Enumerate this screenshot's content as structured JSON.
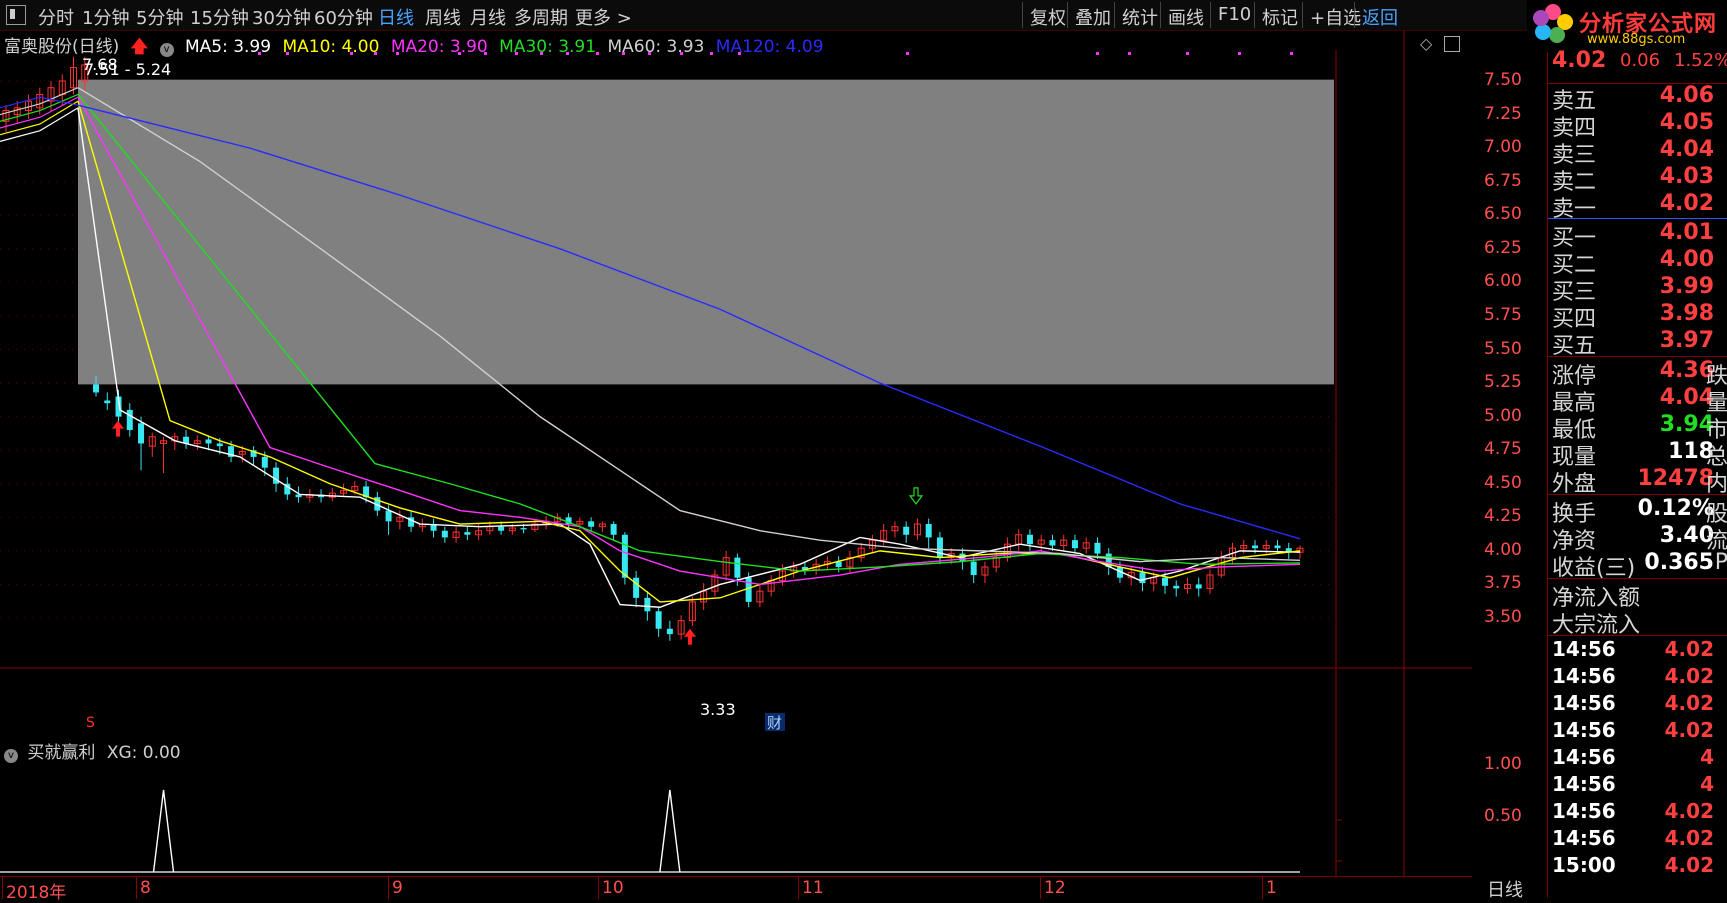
{
  "toolbar": {
    "periods": [
      "分时",
      "1分钟",
      "5分钟",
      "15分钟",
      "30分钟",
      "60分钟",
      "日线",
      "周线",
      "月线",
      "多周期",
      "更多 >"
    ],
    "active_period": "日线",
    "right_items": [
      "复权",
      "叠加",
      "统计",
      "画线",
      "F10",
      "标记",
      "+自选",
      "返回"
    ]
  },
  "logo": {
    "text": "分析家公式网",
    "url": "www.88gs.com"
  },
  "stock": {
    "name": "富奥股份(日线)"
  },
  "legend": {
    "ma5": {
      "label": "MA5: 3.99",
      "color": "#ffffff"
    },
    "ma10": {
      "label": "MA10: 4.00",
      "color": "#ffff00"
    },
    "ma20": {
      "label": "MA20: 3.90",
      "color": "#ff33ff"
    },
    "ma30": {
      "label": "MA30: 3.91",
      "color": "#22dd22"
    },
    "ma60": {
      "label": "MA60: 3.93",
      "color": "#d0d0d0"
    },
    "ma120": {
      "label": "MA120: 4.09",
      "color": "#2a2aff"
    }
  },
  "chart_annotations": {
    "high_label": "7.68",
    "range_label": "7.51 - 5.24",
    "low_label": "3.33",
    "s_marker": "S",
    "cai_marker": "财"
  },
  "chart_data": {
    "type": "candlestick",
    "y_ticks": [
      "7.50",
      "7.25",
      "7.00",
      "6.75",
      "6.50",
      "6.25",
      "6.00",
      "5.75",
      "5.50",
      "5.25",
      "5.00",
      "4.75",
      "4.50",
      "4.25",
      "4.00",
      "3.75",
      "3.50"
    ],
    "ylim": [
      3.28,
      7.72
    ],
    "x_month_labels": [
      "2018年",
      "8",
      "9",
      "10",
      "11",
      "12",
      "1"
    ],
    "box_range": [
      5.24,
      7.51
    ],
    "candles": [
      [
        7.2,
        7.28,
        7.12,
        7.32
      ],
      [
        7.25,
        7.3,
        7.18,
        7.35
      ],
      [
        7.28,
        7.35,
        7.22,
        7.4
      ],
      [
        7.3,
        7.4,
        7.25,
        7.45
      ],
      [
        7.35,
        7.45,
        7.28,
        7.5
      ],
      [
        7.4,
        7.5,
        7.32,
        7.55
      ],
      [
        7.45,
        7.6,
        7.4,
        7.68
      ],
      [
        7.5,
        7.62,
        7.42,
        7.68
      ],
      [
        5.24,
        5.18,
        5.15,
        5.3
      ],
      [
        5.12,
        5.1,
        5.05,
        5.18
      ],
      [
        5.15,
        5.0,
        4.95,
        5.2
      ],
      [
        5.05,
        4.9,
        4.85,
        5.1
      ],
      [
        4.95,
        4.8,
        4.6,
        5.0
      ],
      [
        4.78,
        4.85,
        4.7,
        4.88
      ],
      [
        4.8,
        4.82,
        4.58,
        4.85
      ],
      [
        4.82,
        4.85,
        4.75,
        4.88
      ],
      [
        4.85,
        4.8,
        4.76,
        4.9
      ],
      [
        4.8,
        4.82,
        4.75,
        4.86
      ],
      [
        4.83,
        4.8,
        4.75,
        4.86
      ],
      [
        4.8,
        4.78,
        4.72,
        4.84
      ],
      [
        4.78,
        4.7,
        4.66,
        4.82
      ],
      [
        4.72,
        4.74,
        4.66,
        4.78
      ],
      [
        4.75,
        4.7,
        4.64,
        4.78
      ],
      [
        4.7,
        4.62,
        4.56,
        4.74
      ],
      [
        4.62,
        4.5,
        4.44,
        4.66
      ],
      [
        4.5,
        4.42,
        4.38,
        4.55
      ],
      [
        4.42,
        4.4,
        4.36,
        4.48
      ],
      [
        4.4,
        4.42,
        4.36,
        4.46
      ],
      [
        4.42,
        4.4,
        4.36,
        4.46
      ],
      [
        4.4,
        4.43,
        4.37,
        4.47
      ],
      [
        4.43,
        4.45,
        4.4,
        4.5
      ],
      [
        4.45,
        4.48,
        4.42,
        4.52
      ],
      [
        4.48,
        4.4,
        4.36,
        4.52
      ],
      [
        4.4,
        4.3,
        4.26,
        4.44
      ],
      [
        4.3,
        4.22,
        4.12,
        4.34
      ],
      [
        4.22,
        4.25,
        4.16,
        4.3
      ],
      [
        4.25,
        4.18,
        4.14,
        4.3
      ],
      [
        4.18,
        4.2,
        4.14,
        4.24
      ],
      [
        4.2,
        4.15,
        4.1,
        4.24
      ],
      [
        4.15,
        4.1,
        4.06,
        4.18
      ],
      [
        4.1,
        4.14,
        4.06,
        4.18
      ],
      [
        4.14,
        4.12,
        4.08,
        4.18
      ],
      [
        4.12,
        4.15,
        4.08,
        4.2
      ],
      [
        4.15,
        4.18,
        4.12,
        4.22
      ],
      [
        4.18,
        4.15,
        4.12,
        4.22
      ],
      [
        4.15,
        4.17,
        4.12,
        4.2
      ],
      [
        4.17,
        4.16,
        4.13,
        4.2
      ],
      [
        4.16,
        4.2,
        4.14,
        4.24
      ],
      [
        4.2,
        4.22,
        4.16,
        4.26
      ],
      [
        4.22,
        4.25,
        4.18,
        4.28
      ],
      [
        4.25,
        4.2,
        4.16,
        4.28
      ],
      [
        4.2,
        4.22,
        4.16,
        4.25
      ],
      [
        4.22,
        4.18,
        4.15,
        4.25
      ],
      [
        4.18,
        4.2,
        4.14,
        4.22
      ],
      [
        4.2,
        4.12,
        4.08,
        4.22
      ],
      [
        4.12,
        3.8,
        3.75,
        4.14
      ],
      [
        3.8,
        3.65,
        3.58,
        3.85
      ],
      [
        3.65,
        3.55,
        3.48,
        3.7
      ],
      [
        3.55,
        3.42,
        3.36,
        3.58
      ],
      [
        3.42,
        3.38,
        3.33,
        3.48
      ],
      [
        3.38,
        3.48,
        3.34,
        3.52
      ],
      [
        3.48,
        3.62,
        3.44,
        3.66
      ],
      [
        3.62,
        3.7,
        3.56,
        3.76
      ],
      [
        3.7,
        3.82,
        3.66,
        3.86
      ],
      [
        3.82,
        3.95,
        3.78,
        4.0
      ],
      [
        3.95,
        3.8,
        3.74,
        3.98
      ],
      [
        3.8,
        3.62,
        3.58,
        3.84
      ],
      [
        3.62,
        3.7,
        3.58,
        3.76
      ],
      [
        3.7,
        3.78,
        3.66,
        3.82
      ],
      [
        3.78,
        3.85,
        3.74,
        3.9
      ],
      [
        3.85,
        3.88,
        3.8,
        3.92
      ],
      [
        3.88,
        3.86,
        3.82,
        3.92
      ],
      [
        3.86,
        3.9,
        3.82,
        3.94
      ],
      [
        3.9,
        3.92,
        3.86,
        3.96
      ],
      [
        3.92,
        3.88,
        3.84,
        3.96
      ],
      [
        3.88,
        3.95,
        3.84,
        4.0
      ],
      [
        3.95,
        4.02,
        3.92,
        4.06
      ],
      [
        4.02,
        4.08,
        3.98,
        4.12
      ],
      [
        4.08,
        4.15,
        4.04,
        4.2
      ],
      [
        4.15,
        4.18,
        4.1,
        4.22
      ],
      [
        4.18,
        4.12,
        4.06,
        4.22
      ],
      [
        4.12,
        4.2,
        4.08,
        4.24
      ],
      [
        4.2,
        4.1,
        4.02,
        4.24
      ],
      [
        4.1,
        3.95,
        3.9,
        4.14
      ],
      [
        3.95,
        3.98,
        3.9,
        4.02
      ],
      [
        3.98,
        3.92,
        3.86,
        4.02
      ],
      [
        3.92,
        3.82,
        3.76,
        3.96
      ],
      [
        3.82,
        3.88,
        3.76,
        3.92
      ],
      [
        3.88,
        3.95,
        3.84,
        4.0
      ],
      [
        3.95,
        4.05,
        3.92,
        4.1
      ],
      [
        4.05,
        4.12,
        4.0,
        4.16
      ],
      [
        4.12,
        4.05,
        4.0,
        4.16
      ],
      [
        4.05,
        4.08,
        4.0,
        4.12
      ],
      [
        4.08,
        4.04,
        4.0,
        4.12
      ],
      [
        4.04,
        4.08,
        4.0,
        4.12
      ],
      [
        4.08,
        4.02,
        3.98,
        4.12
      ],
      [
        4.02,
        4.06,
        3.98,
        4.1
      ],
      [
        4.06,
        3.98,
        3.94,
        4.1
      ],
      [
        3.98,
        3.88,
        3.82,
        4.02
      ],
      [
        3.88,
        3.8,
        3.76,
        3.92
      ],
      [
        3.8,
        3.84,
        3.74,
        3.88
      ],
      [
        3.84,
        3.76,
        3.7,
        3.88
      ],
      [
        3.76,
        3.8,
        3.7,
        3.84
      ],
      [
        3.8,
        3.74,
        3.68,
        3.84
      ],
      [
        3.74,
        3.72,
        3.66,
        3.78
      ],
      [
        3.72,
        3.75,
        3.68,
        3.8
      ],
      [
        3.75,
        3.72,
        3.66,
        3.8
      ],
      [
        3.72,
        3.82,
        3.68,
        3.86
      ],
      [
        3.82,
        3.95,
        3.8,
        4.0
      ],
      [
        3.95,
        4.02,
        3.9,
        4.06
      ],
      [
        4.02,
        4.04,
        3.98,
        4.08
      ],
      [
        4.04,
        4.02,
        3.98,
        4.08
      ],
      [
        4.02,
        4.04,
        3.98,
        4.08
      ],
      [
        4.04,
        4.02,
        3.98,
        4.08
      ],
      [
        4.02,
        3.99,
        3.94,
        4.06
      ],
      [
        3.99,
        4.02,
        3.94,
        4.04
      ]
    ],
    "ma_lines": {
      "ma5": [
        [
          78,
          7.3
        ],
        [
          120,
          5.05
        ],
        [
          175,
          4.82
        ],
        [
          240,
          4.7
        ],
        [
          300,
          4.42
        ],
        [
          360,
          4.4
        ],
        [
          420,
          4.2
        ],
        [
          480,
          4.18
        ],
        [
          560,
          4.2
        ],
        [
          590,
          4.05
        ],
        [
          620,
          3.6
        ],
        [
          660,
          3.58
        ],
        [
          720,
          3.75
        ],
        [
          800,
          3.9
        ],
        [
          860,
          4.1
        ],
        [
          900,
          4.05
        ],
        [
          960,
          3.95
        ],
        [
          1020,
          4.05
        ],
        [
          1080,
          3.98
        ],
        [
          1140,
          3.78
        ],
        [
          1180,
          3.85
        ],
        [
          1240,
          4.0
        ],
        [
          1300,
          3.99
        ]
      ],
      "ma10": [
        [
          78,
          7.35
        ],
        [
          170,
          4.97
        ],
        [
          220,
          4.82
        ],
        [
          270,
          4.7
        ],
        [
          330,
          4.5
        ],
        [
          400,
          4.32
        ],
        [
          460,
          4.2
        ],
        [
          540,
          4.22
        ],
        [
          580,
          4.15
        ],
        [
          620,
          3.85
        ],
        [
          660,
          3.62
        ],
        [
          720,
          3.65
        ],
        [
          800,
          3.85
        ],
        [
          880,
          4.0
        ],
        [
          940,
          3.95
        ],
        [
          1000,
          3.98
        ],
        [
          1060,
          3.98
        ],
        [
          1120,
          3.88
        ],
        [
          1170,
          3.8
        ],
        [
          1240,
          3.95
        ],
        [
          1300,
          4.0
        ]
      ],
      "ma20": [
        [
          78,
          7.38
        ],
        [
          270,
          4.77
        ],
        [
          330,
          4.62
        ],
        [
          400,
          4.45
        ],
        [
          460,
          4.3
        ],
        [
          520,
          4.25
        ],
        [
          580,
          4.18
        ],
        [
          620,
          4.0
        ],
        [
          680,
          3.85
        ],
        [
          760,
          3.75
        ],
        [
          840,
          3.82
        ],
        [
          900,
          3.9
        ],
        [
          980,
          3.95
        ],
        [
          1040,
          4.0
        ],
        [
          1100,
          3.92
        ],
        [
          1160,
          3.85
        ],
        [
          1220,
          3.88
        ],
        [
          1300,
          3.9
        ]
      ],
      "ma30": [
        [
          78,
          7.4
        ],
        [
          375,
          4.65
        ],
        [
          450,
          4.5
        ],
        [
          520,
          4.35
        ],
        [
          580,
          4.18
        ],
        [
          640,
          4.0
        ],
        [
          720,
          3.92
        ],
        [
          800,
          3.85
        ],
        [
          880,
          3.88
        ],
        [
          960,
          3.92
        ],
        [
          1040,
          3.98
        ],
        [
          1120,
          3.95
        ],
        [
          1200,
          3.9
        ],
        [
          1300,
          3.91
        ]
      ],
      "ma60": [
        [
          78,
          7.45
        ],
        [
          200,
          6.9
        ],
        [
          330,
          6.2
        ],
        [
          440,
          5.6
        ],
        [
          540,
          5.0
        ],
        [
          620,
          4.6
        ],
        [
          680,
          4.3
        ],
        [
          760,
          4.15
        ],
        [
          820,
          4.08
        ],
        [
          900,
          4.02
        ],
        [
          980,
          4.0
        ],
        [
          1060,
          3.98
        ],
        [
          1140,
          3.92
        ],
        [
          1220,
          3.95
        ],
        [
          1300,
          3.93
        ]
      ],
      "ma120": [
        [
          78,
          7.32
        ],
        [
          250,
          7.0
        ],
        [
          400,
          6.65
        ],
        [
          560,
          6.25
        ],
        [
          720,
          5.8
        ],
        [
          880,
          5.25
        ],
        [
          1040,
          4.78
        ],
        [
          1180,
          4.35
        ],
        [
          1300,
          4.09
        ]
      ]
    },
    "sub_indicator": {
      "name": "买就赢利",
      "label": "XG: 0.00",
      "y_ticks": [
        "1.00",
        "0.50"
      ],
      "spikes_at_candle": [
        14,
        59
      ]
    }
  },
  "sub_legend": {
    "name": "买就赢利",
    "value": "XG: 0.00"
  },
  "right_panel": {
    "last_price": "4.02",
    "change": "0.06",
    "change_pct": "1.52%",
    "asks": [
      {
        "label": "卖五",
        "price": "4.06"
      },
      {
        "label": "卖四",
        "price": "4.05"
      },
      {
        "label": "卖三",
        "price": "4.04"
      },
      {
        "label": "卖二",
        "price": "4.03"
      },
      {
        "label": "卖一",
        "price": "4.02"
      }
    ],
    "bids": [
      {
        "label": "买一",
        "price": "4.01"
      },
      {
        "label": "买二",
        "price": "4.00"
      },
      {
        "label": "买三",
        "price": "3.99"
      },
      {
        "label": "买四",
        "price": "3.98"
      },
      {
        "label": "买五",
        "price": "3.97"
      }
    ],
    "stats": [
      {
        "label": "涨停",
        "value": "4.36",
        "color": "#ff4040",
        "suffix": "跌"
      },
      {
        "label": "最高",
        "value": "4.04",
        "color": "#ff4040",
        "suffix": "量"
      },
      {
        "label": "最低",
        "value": "3.94",
        "color": "#22dd22",
        "suffix": "市"
      },
      {
        "label": "现量",
        "value": "118",
        "color": "#ffffff",
        "suffix": "总"
      },
      {
        "label": "外盘",
        "value": "12478",
        "color": "#ff4040",
        "suffix": "内"
      }
    ],
    "stats2": [
      {
        "label": "换手",
        "value": "0.12%",
        "color": "#ffffff",
        "suffix": "股"
      },
      {
        "label": "净资",
        "value": "3.40",
        "color": "#ffffff",
        "suffix": "流"
      },
      {
        "label": "收益(三)",
        "value": "0.365",
        "color": "#ffffff",
        "suffix": "P"
      }
    ],
    "flow": [
      "净流入额",
      "大宗流入"
    ],
    "ticks": [
      {
        "time": "14:56",
        "price": "4.02"
      },
      {
        "time": "14:56",
        "price": "4.02"
      },
      {
        "time": "14:56",
        "price": "4.02"
      },
      {
        "time": "14:56",
        "price": "4.02"
      },
      {
        "time": "14:56",
        "price": "4"
      },
      {
        "time": "14:56",
        "price": "4"
      },
      {
        "time": "14:56",
        "price": "4.02"
      },
      {
        "time": "14:56",
        "price": "4.02"
      },
      {
        "time": "15:00",
        "price": "4.02"
      }
    ]
  },
  "period_label": "日线"
}
